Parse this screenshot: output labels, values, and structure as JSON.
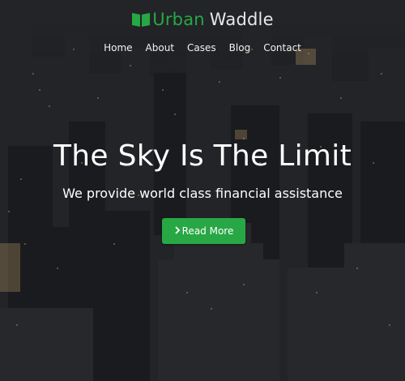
{
  "brand": {
    "part1": "Urban",
    "part2": "Waddle",
    "icon": "book-icon",
    "accent": "#27a844"
  },
  "nav": {
    "items": [
      {
        "label": "Home"
      },
      {
        "label": "About"
      },
      {
        "label": "Cases"
      },
      {
        "label": "Blog"
      },
      {
        "label": "Contact"
      }
    ]
  },
  "hero": {
    "headline": "The Sky Is The Limit",
    "subline": "We provide world class financial assistance",
    "cta_label": "Read More",
    "cta_icon": "chevron-right-icon",
    "cta_color": "#28a745",
    "background": "night city skyline photo"
  }
}
